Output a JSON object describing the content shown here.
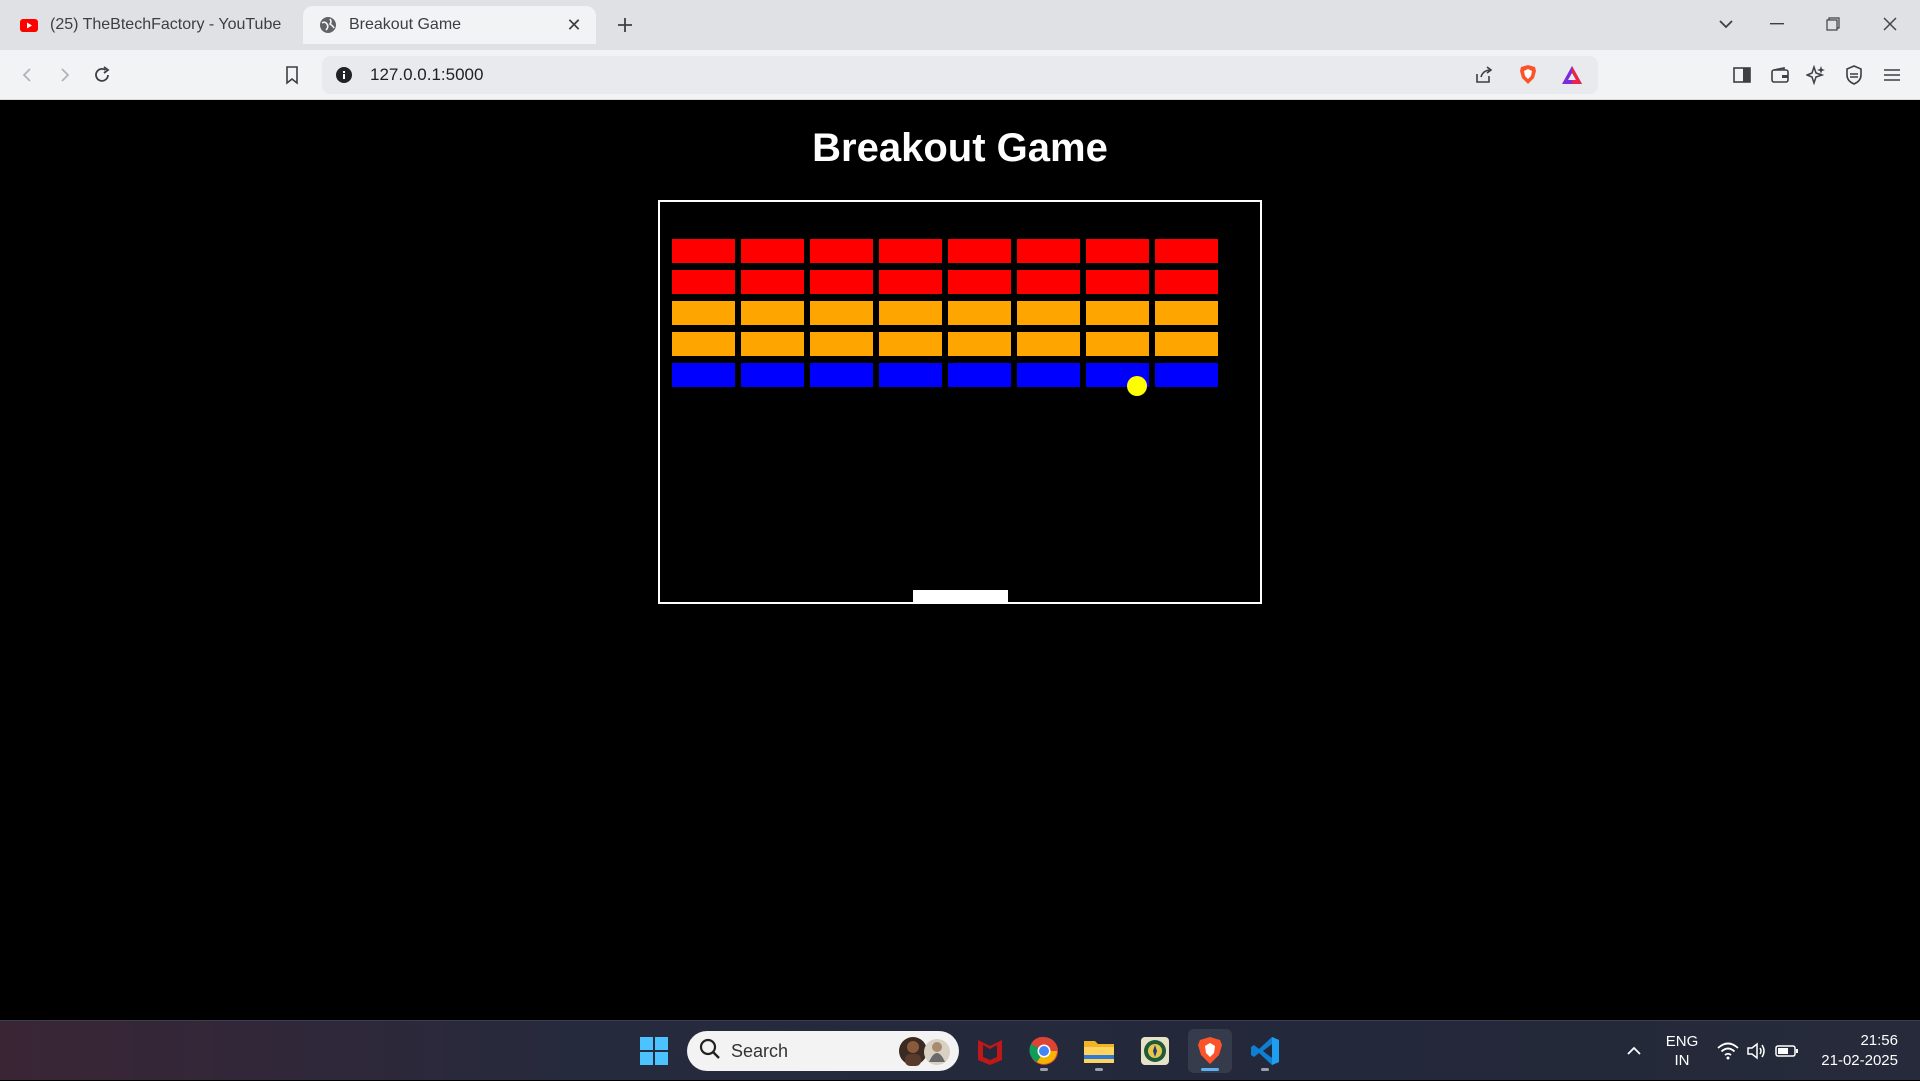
{
  "browser": {
    "tabs": [
      {
        "title": "(25) TheBtechFactory - YouTube",
        "favicon": "youtube-icon",
        "active": false
      },
      {
        "title": "Breakout Game",
        "favicon": "globe-icon",
        "active": true
      }
    ],
    "new_tab_icon": "plus-icon",
    "address": "127.0.0.1:5000"
  },
  "page": {
    "title": "Breakout Game"
  },
  "game": {
    "brick_rows": [
      {
        "color": "#ff0000",
        "count": 8
      },
      {
        "color": "#ff0000",
        "count": 8
      },
      {
        "color": "#ffa500",
        "count": 8
      },
      {
        "color": "#ffa500",
        "count": 8
      },
      {
        "color": "#0000ff",
        "count": 8
      }
    ],
    "ball_color": "#ffff00",
    "paddle_color": "#ffffff",
    "border_color": "#ffffff",
    "background": "#000000"
  },
  "taskbar": {
    "search_placeholder": "Search",
    "apps": [
      "windows-start-icon",
      "mcafee-icon",
      "chrome-icon",
      "file-explorer-icon",
      "emblem-app-icon",
      "brave-icon",
      "vscode-icon"
    ],
    "language": "ENG",
    "region": "IN",
    "time": "21:56",
    "date": "21-02-2025"
  }
}
